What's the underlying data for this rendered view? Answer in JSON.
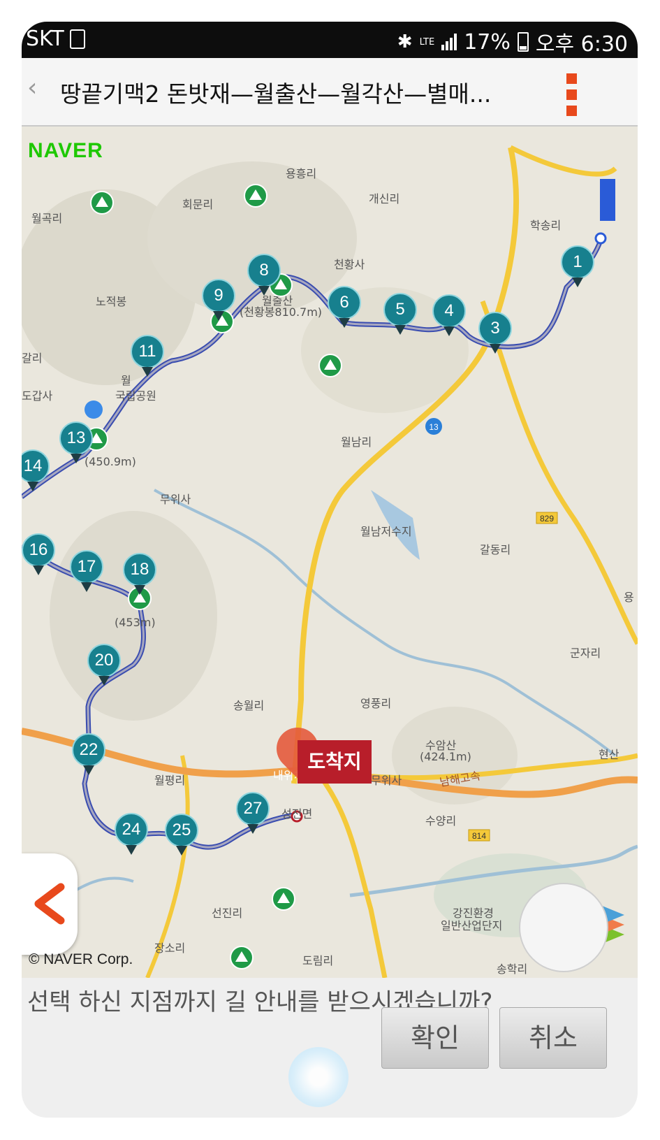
{
  "status_bar": {
    "carrier": "SKT",
    "network": "LTE",
    "battery": "17%",
    "time": "오후 6:30"
  },
  "app_bar": {
    "back_icon": "‹",
    "title": "땅끝기맥2  돈밧재—월출산—월각산—별매..."
  },
  "map": {
    "logo": "NAVER",
    "copyright": "© NAVER Corp.",
    "places": [
      "용흥리",
      "회문리",
      "월곡리",
      "개신리",
      "학송리",
      "천황사",
      "노적봉",
      "(천황봉810.7m)",
      "월출산",
      "갈리",
      "도갑사",
      "월",
      "국립공원",
      "월남리",
      "무위사",
      "월남저수지",
      "갈동리",
      "(450.9m)",
      "(453m)",
      "군자리",
      "송월리",
      "영풍리",
      "수암산",
      "(424.1m)",
      "현산",
      "월평리",
      "무위사",
      "남해고속",
      "내위치",
      "성전면",
      "수양리",
      "선진리",
      "강진환경",
      "일반산업단지",
      "장소리",
      "도림리",
      "송학리",
      "리",
      "용"
    ],
    "road_labels": [
      "13",
      "829",
      "814"
    ],
    "waypoints": [
      "1",
      "3",
      "4",
      "5",
      "6",
      "8",
      "9",
      "11",
      "13",
      "14",
      "16",
      "17",
      "18",
      "20",
      "22",
      "24",
      "25",
      "27"
    ],
    "destination_label": "도착지",
    "colors": {
      "route": "#3a4db0",
      "waypoint": "#17808e",
      "destination": "#b81e2a",
      "road_yellow": "#f4c93a",
      "highway": "#f0a04a"
    }
  },
  "dialog": {
    "prompt": "선택 하신 지점까지 길 안내를 받으시겠습니까?",
    "confirm_label": "확인",
    "cancel_label": "취소"
  }
}
